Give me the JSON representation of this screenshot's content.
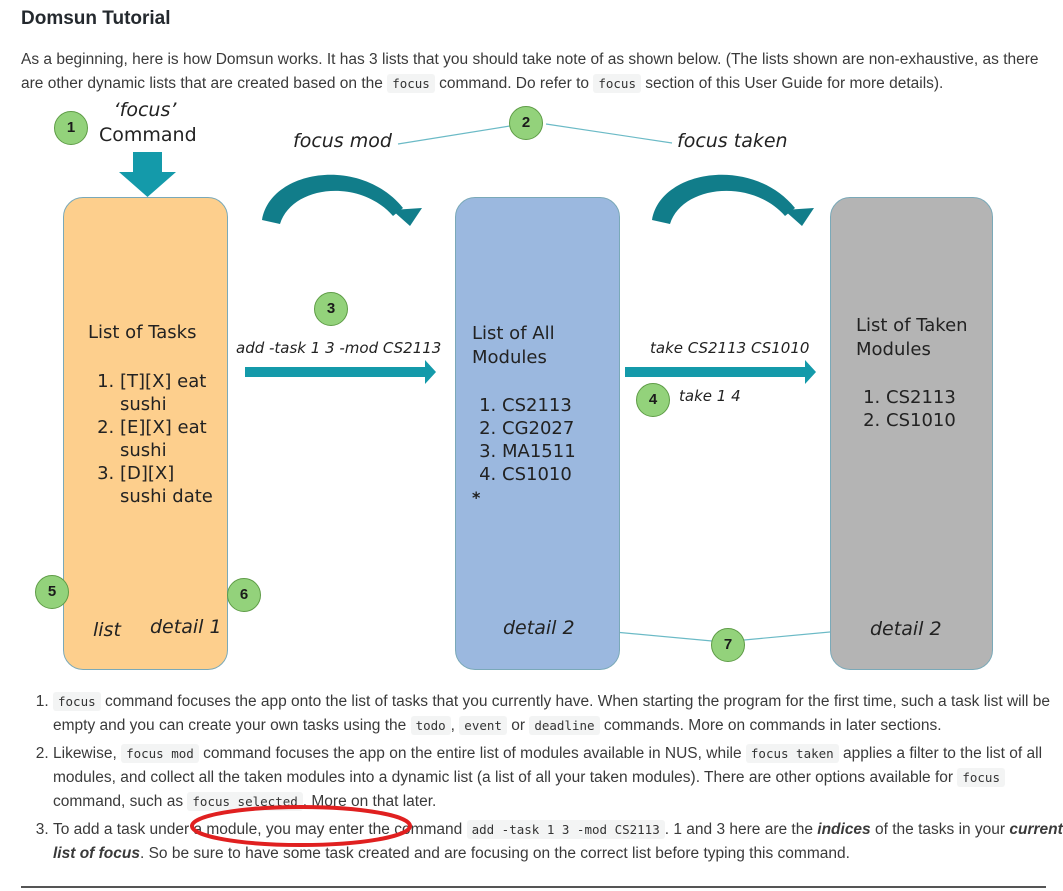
{
  "page": {
    "title": "Domsun Tutorial",
    "intro": {
      "part1": "As a beginning, here is how Domsun works. It has 3 lists that you should take note of as shown below. (The lists shown are non-exhaustive, as there are other dynamic lists that are created based on the ",
      "code1": "focus",
      "part2": " command. Do refer to ",
      "code2": "focus",
      "part3": " section of this User Guide for more details)."
    }
  },
  "diagram": {
    "focus_command_line1": "‘focus’",
    "focus_command_line2": "Command",
    "badges": [
      "1",
      "2",
      "3",
      "4",
      "5",
      "6",
      "7"
    ],
    "labels": {
      "focus_mod": "focus mod",
      "focus_taken": "focus taken",
      "add_task": "add -task 1 3 -mod CS2113",
      "take_cmd": "take CS2113 CS1010",
      "take_idx": "take 1 4",
      "list": "list",
      "detail1": "detail 1",
      "detail2_mid": "detail 2",
      "detail2_right": "detail 2"
    },
    "tasks_panel": {
      "title": "List of Tasks",
      "items": [
        "[T][X] eat sushi",
        "[E][X] eat sushi",
        "[D][X] sushi date"
      ]
    },
    "modules_panel": {
      "title": "List of All Modules",
      "items": [
        "CS2113",
        "CG2027",
        "MA1511",
        "CS1010"
      ],
      "more": "*"
    },
    "taken_panel": {
      "title": "List of Taken Modules",
      "items": [
        "CS2113",
        "CS1010"
      ]
    },
    "colors": {
      "tasks_bg": "#fdcf8d",
      "modules_bg": "#9bb8df",
      "taken_bg": "#b4b4b4",
      "arrow": "#149aaa",
      "badge": "#93d27b",
      "annotation_circle": "#e02020"
    }
  },
  "notes": [
    {
      "a": "",
      "c1": "focus",
      "b": " command focuses the app onto the list of tasks that you currently have. When starting the program for the first time, such a task list will be empty and you can create your own tasks using the ",
      "c2": "todo",
      "d": ", ",
      "c3": "event",
      "e": " or ",
      "c4": "deadline",
      "f": " commands. More on commands in later sections."
    },
    {
      "a": "Likewise, ",
      "c1": "focus mod",
      "b": " command focuses the app on the entire list of modules available in NUS, while ",
      "c2": "focus taken",
      "d": " applies a filter to the list of all modules, and collect all the taken modules into a dynamic list (a list of all your taken modules). There are other options available for ",
      "c3": "focus",
      "e": " command, such as ",
      "c4": "focus selected",
      "f": ". More on that later."
    },
    {
      "a": "To add a task under a module, you may enter the command ",
      "c1": "add -task 1 3 -mod CS2113",
      "b": ". 1 and 3 here are the ",
      "em1": "indices",
      "d": " of the tasks in your ",
      "em2": "current list of focus",
      "f": ". So be sure to have some task created and are focusing on the correct list before typing this command."
    }
  ]
}
